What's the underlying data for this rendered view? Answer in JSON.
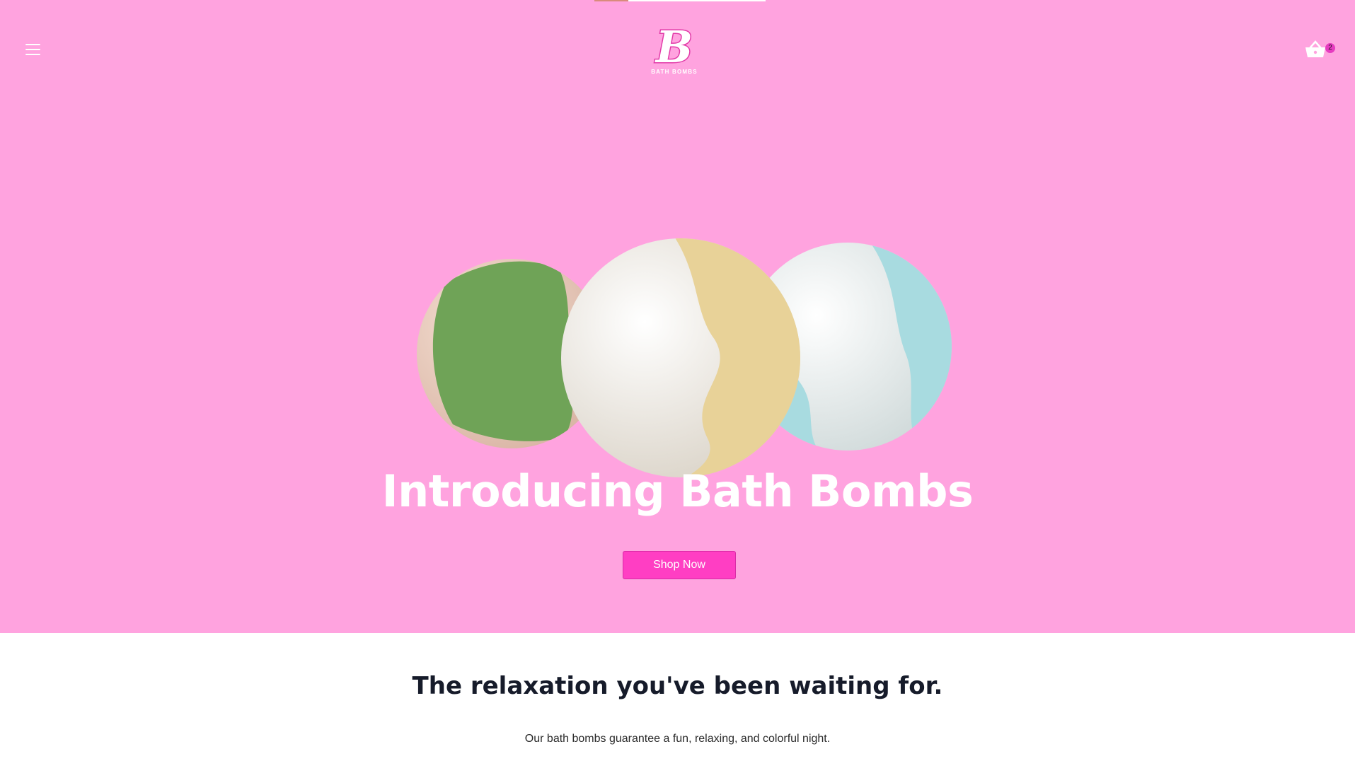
{
  "header": {
    "menu_icon": "hamburger-menu-icon",
    "logo": {
      "letter": "B",
      "text": "BATH BOMBS"
    },
    "cart": {
      "icon": "basket-icon",
      "count": "2"
    }
  },
  "hero": {
    "image": "three-bath-bombs-image",
    "title": "Introducing Bath Bombs",
    "cta_label": "Shop Now"
  },
  "intro": {
    "heading": "The relaxation you've been waiting for.",
    "text": "Our bath bombs guarantee a fun, relaxing, and colorful night."
  },
  "colors": {
    "hero_bg": "#ffa3df",
    "accent": "#ff3ec3",
    "heading_text": "#161b2a"
  }
}
